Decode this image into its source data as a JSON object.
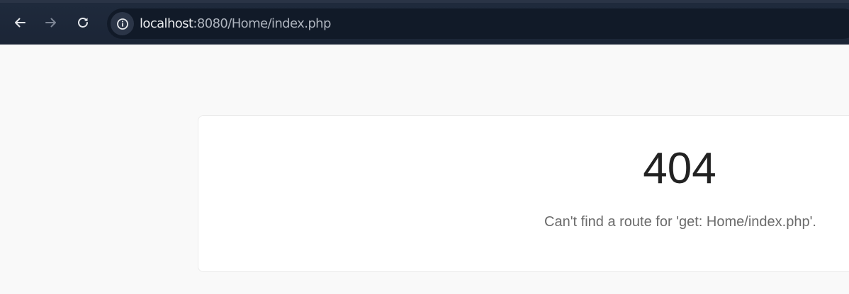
{
  "browser": {
    "url_host": "localhost",
    "url_rest": ":8080/Home/index.php",
    "icons": {
      "back": "arrow-left-icon",
      "forward": "arrow-right-icon",
      "reload": "reload-icon",
      "site_info": "info-icon"
    }
  },
  "page": {
    "error_code": "404",
    "message": "Can't find a route for 'get: Home/index.php'."
  }
}
